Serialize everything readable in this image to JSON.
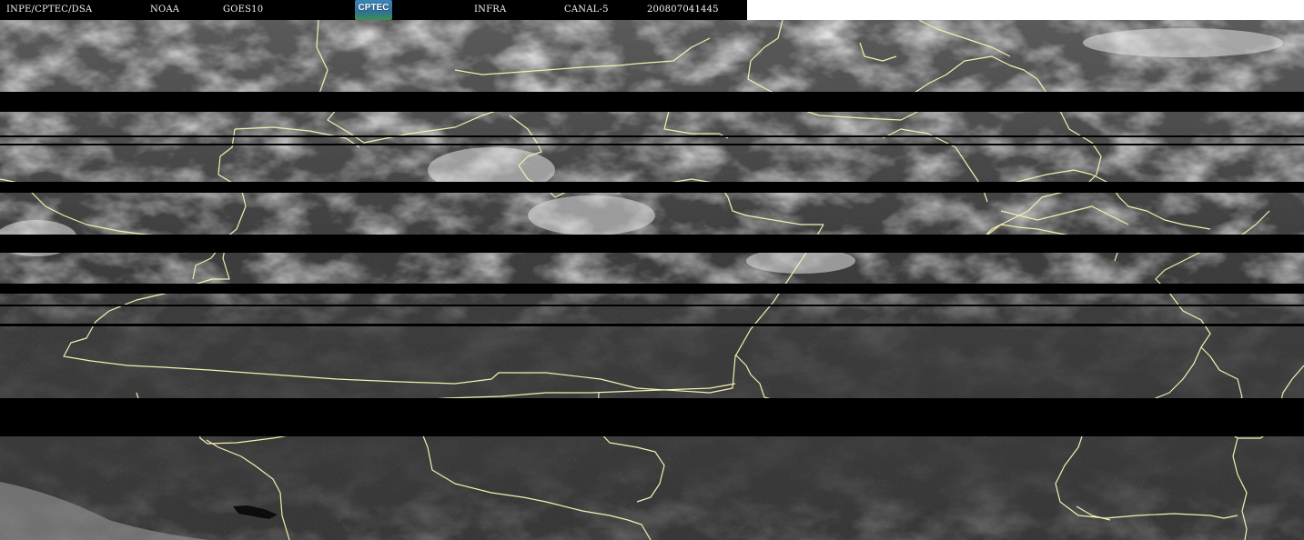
{
  "header": {
    "institution": "INPE/CPTEC/DSA",
    "agency": "NOAA",
    "satellite": "GOES10",
    "logo_text": "CPTEC",
    "product": "INFRA",
    "channel": "CANAL-5",
    "datetime": "200807041445"
  },
  "colors": {
    "header_bg": "#000000",
    "header_text": "#f2f2f2",
    "border_lines": "#f3f0b0",
    "missing_scanline": "#000000"
  },
  "icons": {
    "logo": "cptec-logo-icon"
  }
}
